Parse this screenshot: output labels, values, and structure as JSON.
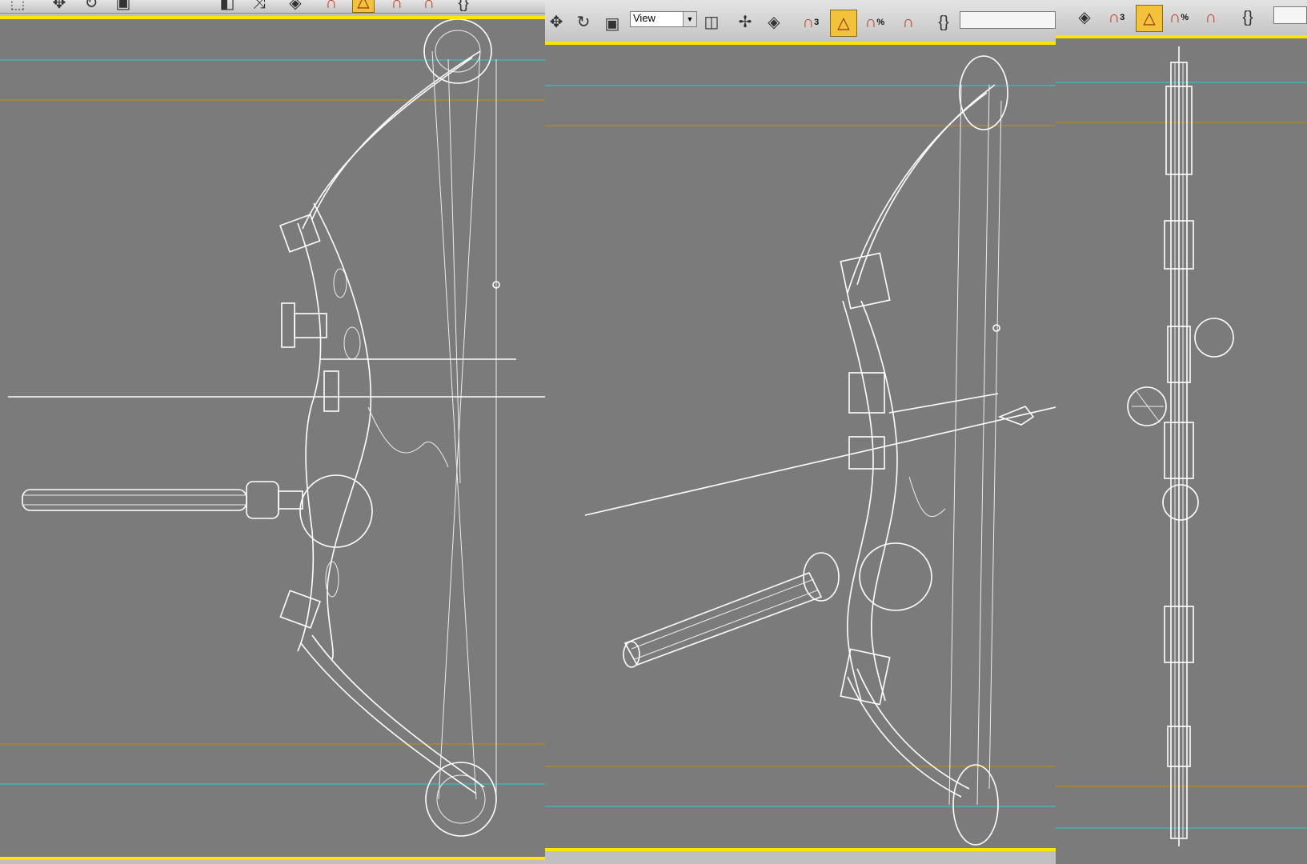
{
  "app": "3D modeling viewports (wireframe)",
  "toolbars": {
    "middle": {
      "reference_coordinate_system": "View"
    }
  },
  "icons": {
    "move": "move-icon",
    "rotate": "rotate-icon",
    "scale": "scale-icon",
    "mirror": "mirror-icon",
    "align": "align-icon",
    "snap_3d": "snap-toggle-3d-icon",
    "angle_snap": "angle-snap-icon",
    "percent_snap": "percent-snap-icon",
    "spinner_snap": "spinner-snap-icon",
    "named_selection": "named-selection-icon"
  },
  "colors": {
    "viewport_bg": "#7b7b7b",
    "active_border": "#ffe600",
    "guide_cyan": "#3fb6b1",
    "guide_orange": "#b58a23",
    "wireframe": "#ffffff"
  },
  "viewports": [
    {
      "view": "front",
      "subject": "compound-bow"
    },
    {
      "view": "perspective",
      "subject": "compound-bow"
    },
    {
      "view": "side",
      "subject": "compound-bow"
    }
  ]
}
